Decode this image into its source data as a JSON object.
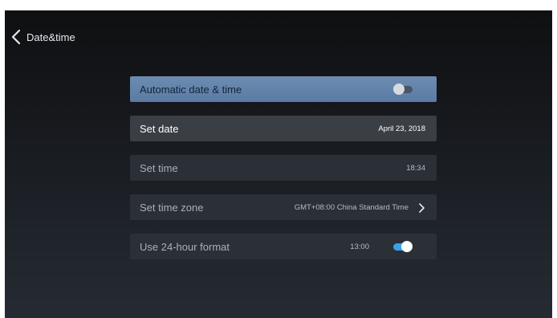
{
  "header": {
    "title": "Date&time",
    "back_icon": "chevron-left-icon"
  },
  "settings": {
    "automatic": {
      "label": "Automatic date & time",
      "enabled": false
    },
    "set_date": {
      "label": "Set date",
      "value": "April 23, 2018"
    },
    "set_time": {
      "label": "Set time",
      "value": "18:34"
    },
    "set_time_zone": {
      "label": "Set time zone",
      "value": "GMT+08:00 China Standard Time",
      "icon": "chevron-right-icon"
    },
    "use_24_hour": {
      "label": "Use 24-hour format",
      "value": "13:00",
      "enabled": true
    }
  },
  "colors": {
    "accent": "#3aa0e8",
    "highlight_row": "#5f80a8"
  }
}
